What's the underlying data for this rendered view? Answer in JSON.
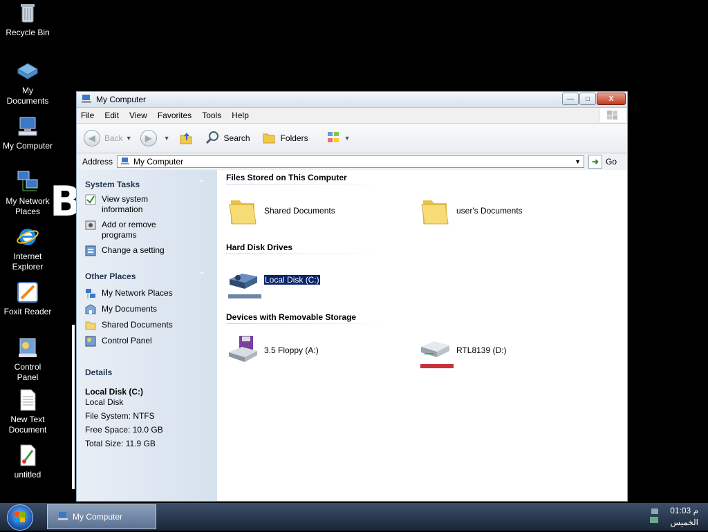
{
  "desktop": {
    "icons": [
      {
        "label1": "Recycle Bin",
        "label2": ""
      },
      {
        "label1": "My",
        "label2": "Documents"
      },
      {
        "label1": "My Computer",
        "label2": ""
      },
      {
        "label1": "My Network",
        "label2": "Places"
      },
      {
        "label1": "Internet",
        "label2": "Explorer"
      },
      {
        "label1": "Foxit Reader",
        "label2": ""
      },
      {
        "label1": "Control",
        "label2": "Panel"
      },
      {
        "label1": "New Text",
        "label2": "Document"
      },
      {
        "label1": "untitled",
        "label2": ""
      }
    ],
    "overlay_letter": "B"
  },
  "window": {
    "title": "My Computer",
    "close_glyph": "X",
    "menu": [
      "File",
      "Edit",
      "View",
      "Favorites",
      "Tools",
      "Help"
    ],
    "toolbar": {
      "back": "Back",
      "search": "Search",
      "folders": "Folders"
    },
    "address": {
      "label": "Address",
      "value": "My Computer",
      "go": "Go"
    },
    "taskpane": {
      "system_tasks": {
        "title": "System Tasks",
        "items": [
          {
            "line1": "View system",
            "line2": "information"
          },
          {
            "line1": "Add or remove",
            "line2": "programs"
          },
          {
            "line1": "Change a setting",
            "line2": ""
          }
        ]
      },
      "other_places": {
        "title": "Other Places",
        "items": [
          "My Network Places",
          "My Documents",
          "Shared Documents",
          "Control Panel"
        ]
      },
      "details": {
        "title": "Details",
        "name": "Local Disk (C:)",
        "type": "Local Disk",
        "file_system": "File System: NTFS",
        "free_space": "Free Space: 10.0 GB",
        "total_size": "Total Size: 11.9 GB"
      }
    },
    "groups": {
      "files": {
        "title": "Files Stored on This Computer",
        "items": [
          "Shared Documents",
          "user's Documents"
        ]
      },
      "hard_disks": {
        "title": "Hard Disk Drives",
        "items": [
          "Local Disk (C:)"
        ]
      },
      "removable": {
        "title": "Devices with Removable Storage",
        "items": [
          "3.5 Floppy (A:)",
          "RTL8139 (D:)"
        ]
      }
    }
  },
  "taskbar": {
    "task_label": "My Computer",
    "clock": "01:03 م",
    "day": "الخميس"
  },
  "colors": {
    "selection": "#0a246a",
    "disk_bar": "#6a86a6",
    "cd_bar": "#c8303a"
  }
}
